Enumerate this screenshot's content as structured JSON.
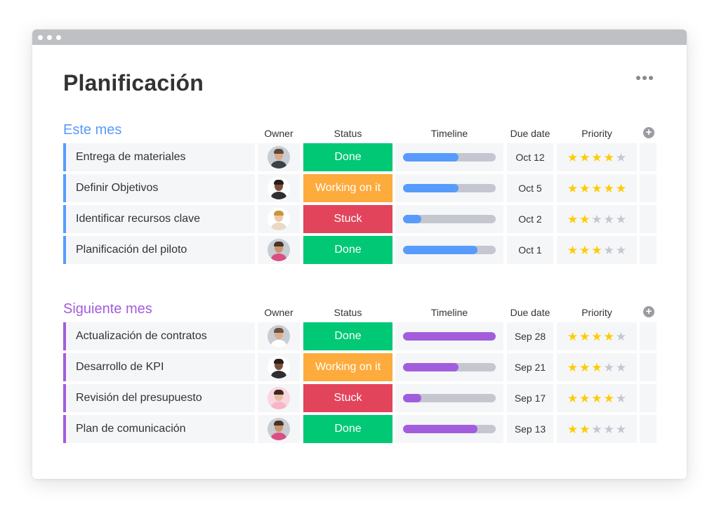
{
  "page": {
    "title": "Planificación"
  },
  "columns": {
    "owner": "Owner",
    "status": "Status",
    "timeline": "Timeline",
    "due": "Due date",
    "priority": "Priority"
  },
  "colors": {
    "done": "#00c875",
    "working": "#fdab3d",
    "stuck": "#e2445c",
    "blue": "#579bfc",
    "purple": "#a25ddc",
    "star_on": "#ffcb00",
    "star_off": "#c5c7d0"
  },
  "groups": [
    {
      "title": "Este mes",
      "color": "#579bfc",
      "rows": [
        {
          "name": "Entrega de materiales",
          "status": "Done",
          "status_color": "#00c875",
          "timeline_progress": 0.6,
          "due": "Oct 12",
          "stars": 4,
          "avatar": {
            "bg": "#c8cdd3",
            "skin": "#d9a98a",
            "hair": "#5a4a3c",
            "shirt": "#3c4148"
          }
        },
        {
          "name": "Definir Objetivos",
          "status": "Working on it",
          "status_color": "#fdab3d",
          "timeline_progress": 0.6,
          "due": "Oct 5",
          "stars": 5,
          "avatar": {
            "bg": "#ffffff",
            "skin": "#7a5038",
            "hair": "#2a1e18",
            "shirt": "#2e2e33"
          }
        },
        {
          "name": "Identificar recursos clave",
          "status": "Stuck",
          "status_color": "#e2445c",
          "timeline_progress": 0.2,
          "due": "Oct 2",
          "stars": 2,
          "avatar": {
            "bg": "#ffffff",
            "skin": "#f0c9a5",
            "hair": "#c8963c",
            "shirt": "#e8d9c8"
          }
        },
        {
          "name": "Planificación del piloto",
          "status": "Done",
          "status_color": "#00c875",
          "timeline_progress": 0.8,
          "due": "Oct 1",
          "stars": 3,
          "avatar": {
            "bg": "#c8cdd3",
            "skin": "#c9926c",
            "hair": "#4a3426",
            "shirt": "#d94f84"
          }
        }
      ]
    },
    {
      "title": "Siguiente mes",
      "color": "#a25ddc",
      "rows": [
        {
          "name": "Actualización de contratos",
          "status": "Done",
          "status_color": "#00c875",
          "timeline_progress": 1.0,
          "due": "Sep 28",
          "stars": 4,
          "avatar": {
            "bg": "#c8cdd3",
            "skin": "#dcae8c",
            "hair": "#6b5341",
            "shirt": "#ffffff"
          }
        },
        {
          "name": "Desarrollo de KPI",
          "status": "Working on it",
          "status_color": "#fdab3d",
          "timeline_progress": 0.6,
          "due": "Sep 21",
          "stars": 3,
          "avatar": {
            "bg": "#ffffff",
            "skin": "#7a5038",
            "hair": "#2a1e18",
            "shirt": "#2e2e33"
          }
        },
        {
          "name": "Revisión del presupuesto",
          "status": "Stuck",
          "status_color": "#e2445c",
          "timeline_progress": 0.2,
          "due": "Sep 17",
          "stars": 4,
          "avatar": {
            "bg": "#f8d7e0",
            "skin": "#e8bc9c",
            "hair": "#3a2a22",
            "shirt": "#f4b6c8"
          }
        },
        {
          "name": "Plan de comunicación",
          "status": "Done",
          "status_color": "#00c875",
          "timeline_progress": 0.8,
          "due": "Sep 13",
          "stars": 2,
          "avatar": {
            "bg": "#c8cdd3",
            "skin": "#c9926c",
            "hair": "#4a3426",
            "shirt": "#d94f84"
          }
        }
      ]
    }
  ]
}
